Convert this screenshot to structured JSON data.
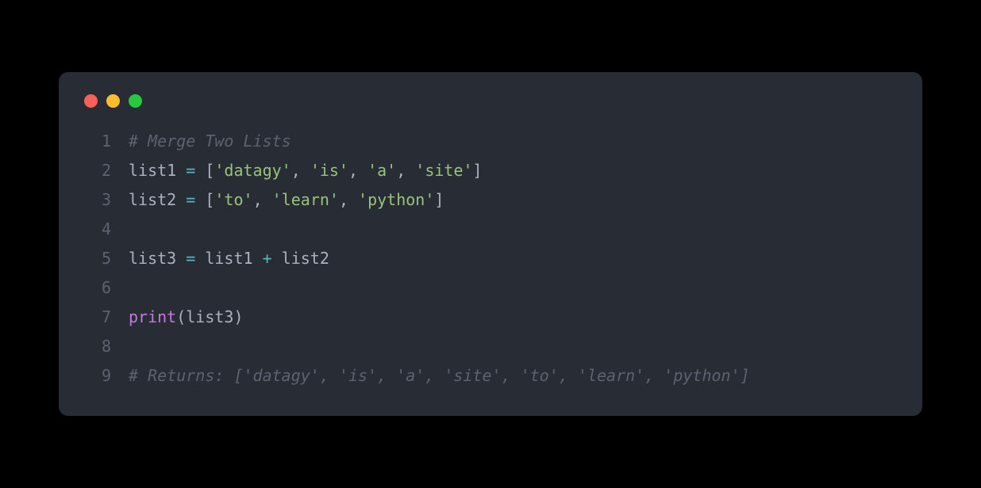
{
  "window": {
    "traffic_lights": [
      "red",
      "yellow",
      "green"
    ]
  },
  "code": {
    "lines": [
      {
        "num": "1",
        "tokens": [
          {
            "cls": "comment",
            "text": "# Merge Two Lists"
          }
        ]
      },
      {
        "num": "2",
        "tokens": [
          {
            "cls": "plain",
            "text": "list1 "
          },
          {
            "cls": "op",
            "text": "="
          },
          {
            "cls": "plain",
            "text": " "
          },
          {
            "cls": "punct",
            "text": "["
          },
          {
            "cls": "string",
            "text": "'datagy'"
          },
          {
            "cls": "punct",
            "text": ", "
          },
          {
            "cls": "string",
            "text": "'is'"
          },
          {
            "cls": "punct",
            "text": ", "
          },
          {
            "cls": "string",
            "text": "'a'"
          },
          {
            "cls": "punct",
            "text": ", "
          },
          {
            "cls": "string",
            "text": "'site'"
          },
          {
            "cls": "punct",
            "text": "]"
          }
        ]
      },
      {
        "num": "3",
        "tokens": [
          {
            "cls": "plain",
            "text": "list2 "
          },
          {
            "cls": "op",
            "text": "="
          },
          {
            "cls": "plain",
            "text": " "
          },
          {
            "cls": "punct",
            "text": "["
          },
          {
            "cls": "string",
            "text": "'to'"
          },
          {
            "cls": "punct",
            "text": ", "
          },
          {
            "cls": "string",
            "text": "'learn'"
          },
          {
            "cls": "punct",
            "text": ", "
          },
          {
            "cls": "string",
            "text": "'python'"
          },
          {
            "cls": "punct",
            "text": "]"
          }
        ]
      },
      {
        "num": "4",
        "tokens": []
      },
      {
        "num": "5",
        "tokens": [
          {
            "cls": "plain",
            "text": "list3 "
          },
          {
            "cls": "op",
            "text": "="
          },
          {
            "cls": "plain",
            "text": " list1 "
          },
          {
            "cls": "op",
            "text": "+"
          },
          {
            "cls": "plain",
            "text": " list2"
          }
        ]
      },
      {
        "num": "6",
        "tokens": []
      },
      {
        "num": "7",
        "tokens": [
          {
            "cls": "func",
            "text": "print"
          },
          {
            "cls": "punct",
            "text": "("
          },
          {
            "cls": "plain",
            "text": "list3"
          },
          {
            "cls": "punct",
            "text": ")"
          }
        ]
      },
      {
        "num": "8",
        "tokens": []
      },
      {
        "num": "9",
        "tokens": [
          {
            "cls": "comment",
            "text": "# Returns: ['datagy', 'is', 'a', 'site', 'to', 'learn', 'python']"
          }
        ]
      }
    ]
  }
}
